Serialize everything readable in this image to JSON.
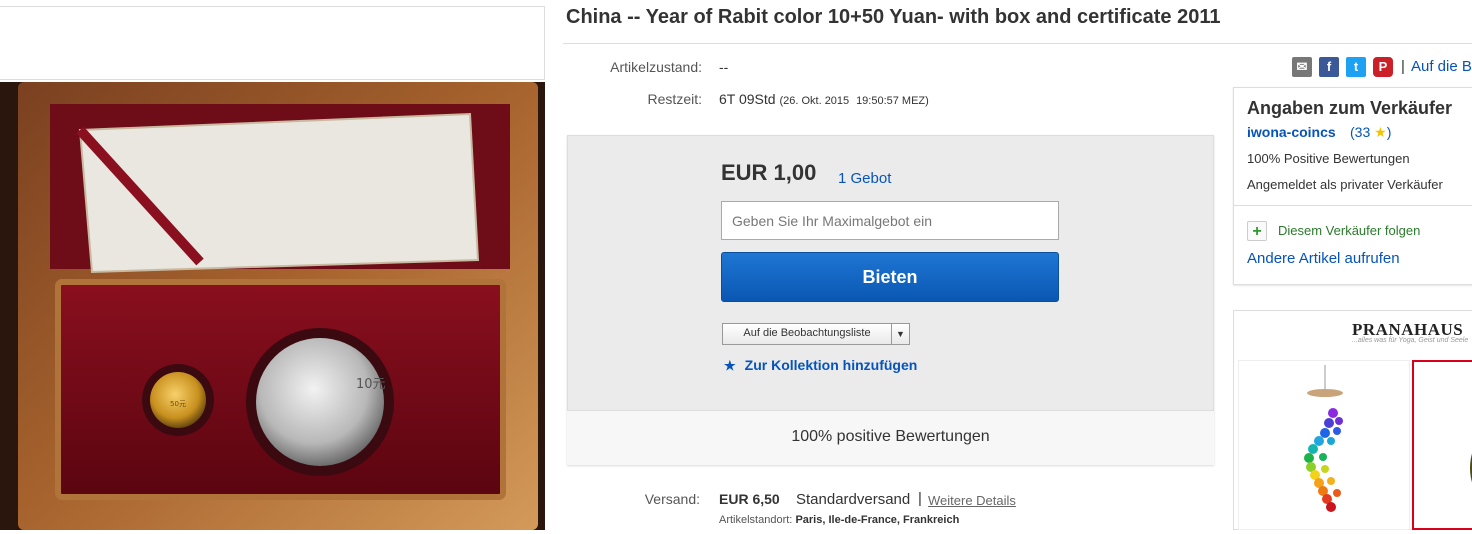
{
  "listing": {
    "title": "China -- Year of Rabit color 10+50 Yuan- with box and certificate 2011",
    "condition_label": "Artikelzustand:",
    "condition_value": "--",
    "time_label": "Restzeit:",
    "time_value": "6T 09Std",
    "end_date": "(26. Okt. 2015",
    "end_time": "19:50:57 MEZ)"
  },
  "bid": {
    "price": "EUR 1,00",
    "bid_count": "1 Gebot",
    "max_bid_placeholder": "Geben Sie Ihr Maximalgebot ein",
    "bid_button": "Bieten",
    "watchlist": "Auf die Beobachtungsliste",
    "collection": "Zur Kollektion hinzufügen",
    "positive_feedback": "100% positive Bewertungen"
  },
  "shipping": {
    "label": "Versand:",
    "price": "EUR 6,50",
    "type": "Standardversand",
    "separator": "|",
    "more": "Weitere Details",
    "location_label": "Artikelstandort:",
    "location": "Paris, Ile-de-France, Frankreich"
  },
  "share": {
    "icons": [
      "email-icon",
      "facebook-icon",
      "twitter-icon",
      "pinterest-icon"
    ],
    "separator": "|",
    "link": "Auf die B"
  },
  "seller": {
    "title": "Angaben zum Verkäufer",
    "name": "iwona-coincs",
    "score_open": "(33",
    "score_star": "★",
    "score_close": ")",
    "positive": "100% Positive Bewertungen",
    "private": "Angemeldet als privater Verkäufer",
    "follow": "Diesem Verkäufer folgen",
    "other_items": "Andere Artikel aufrufen"
  },
  "ad": {
    "logo": "PRANAHAUS",
    "tagline": "...alles was für Yoga, Geist und Seele"
  },
  "product_image": {
    "coin_small_label": "50元",
    "coin_large_label": "10元"
  },
  "colors": {
    "link": "#0654ba",
    "button": "#0a57b3",
    "star": "#f5c400",
    "follow_green": "#2b9a2b",
    "ad_border": "#d9001b"
  }
}
